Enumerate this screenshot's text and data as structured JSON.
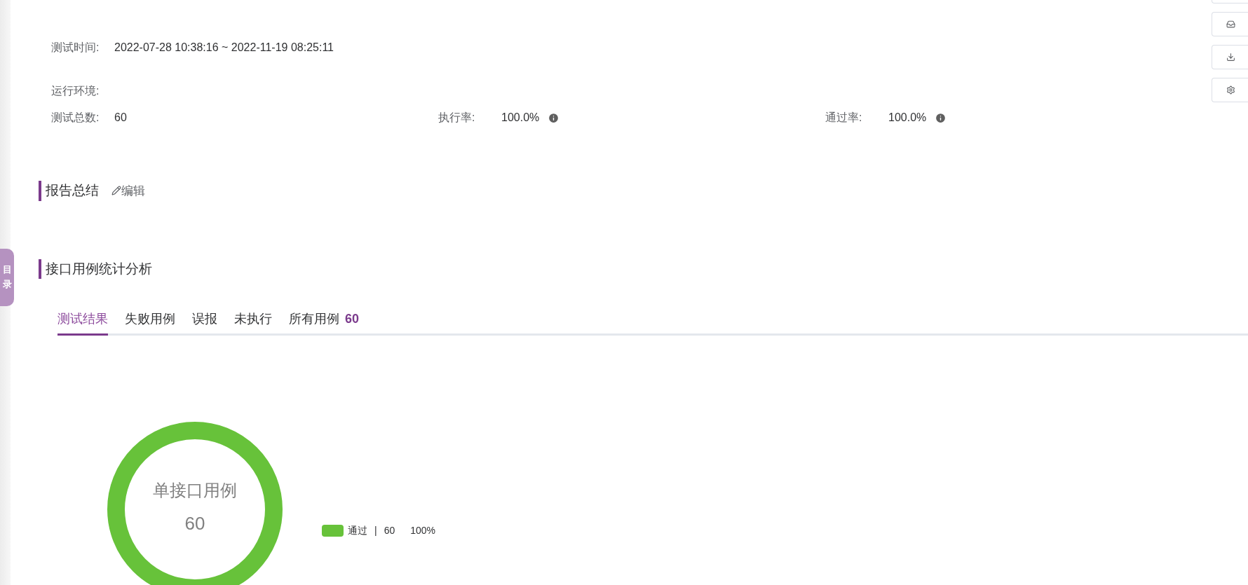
{
  "info": {
    "fields": [
      {
        "label": "测试时间:",
        "value": "2022-07-28 10:38:16 ~ 2022-11-19 08:25:11"
      },
      {
        "label": "运行环境:"
      }
    ],
    "stats": [
      {
        "label": "测试总数:",
        "value": "60",
        "info": false
      },
      {
        "label": "执行率:",
        "value": "100.0%",
        "info": true
      },
      {
        "label": "通过率:",
        "value": "100.0%",
        "info": true
      }
    ]
  },
  "summary_section": {
    "title": "报告总结",
    "edit_link": "编辑"
  },
  "side_tab": {
    "label": "目录"
  },
  "analysis_section": {
    "title": "接口用例统计分析",
    "tabs": [
      {
        "label": "测试结果",
        "selected": true
      },
      {
        "label": "失败用例",
        "selected": false
      },
      {
        "label": "误报",
        "selected": false
      },
      {
        "label": "未执行",
        "selected": false
      },
      {
        "label": "所有用例",
        "count": "60",
        "selected": false
      }
    ],
    "center_title": "单接口用例",
    "center_value": "60",
    "legend": [
      {
        "label": "通过",
        "separator": "|",
        "count": "60",
        "percent": "100%",
        "color": "#67c23a"
      }
    ]
  },
  "toolbar": [
    {
      "kind": "blank"
    },
    {
      "kind": "inbox"
    },
    {
      "kind": "download"
    },
    {
      "kind": "settings"
    }
  ]
}
